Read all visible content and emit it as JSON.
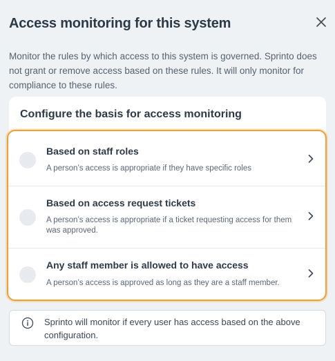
{
  "dialog": {
    "title": "Access monitoring for this system",
    "close_icon": "close-icon",
    "description": "Monitor the rules by which access to this system is governed. Sprinto does not grant or remove access based on these rules. It will only monitor for compliance to these rules."
  },
  "config": {
    "title": "Configure the basis for access monitoring",
    "options": [
      {
        "title": "Based on staff roles",
        "description": "A person’s access is appropriate if they have specific roles"
      },
      {
        "title": "Based on access request tickets",
        "description": "A person’s access is appropriate if a ticket requesting access for them was approved."
      },
      {
        "title": "Any staff member is allowed to have access",
        "description": "A person’s access is approved as long as they are a staff member."
      }
    ]
  },
  "info": {
    "icon": "info-icon",
    "text": "Sprinto will monitor if every user has access based on the above configuration."
  },
  "colors": {
    "highlight_border": "#f0a030",
    "background": "#eef2f5"
  }
}
